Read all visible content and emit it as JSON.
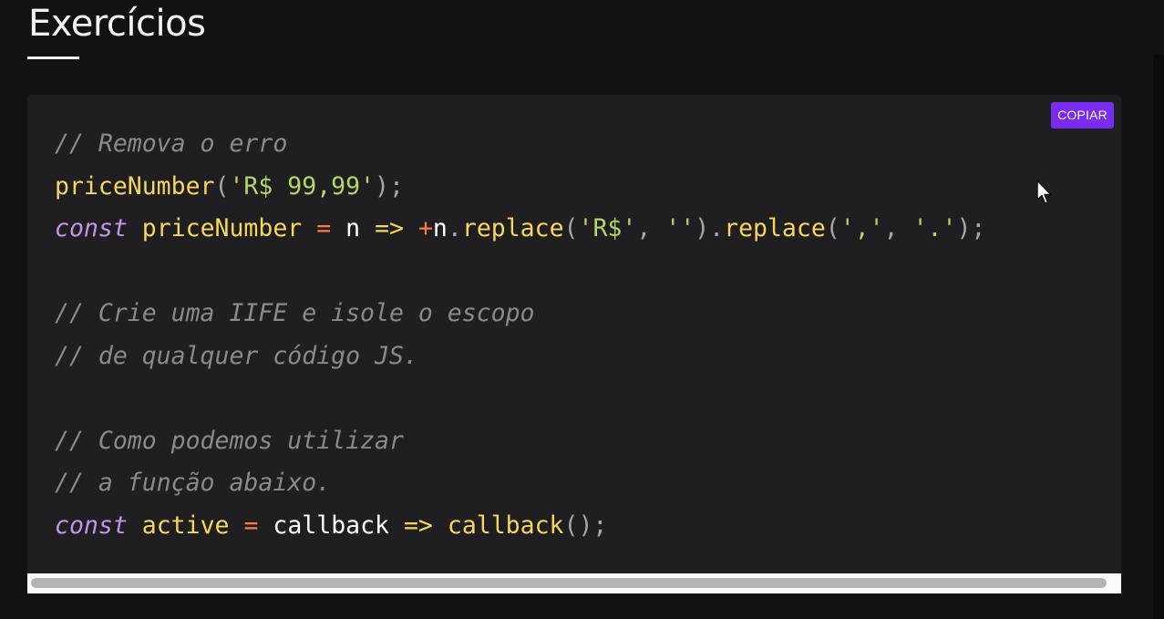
{
  "section": {
    "title": "Exercícios"
  },
  "code_block": {
    "copy_label": "COPIAR",
    "lines": [
      [
        {
          "t": "// Remova o erro",
          "c": "cm"
        }
      ],
      [
        {
          "t": "priceNumber",
          "c": "fn"
        },
        {
          "t": "(",
          "c": "pu"
        },
        {
          "t": "'R$ 99,99'",
          "c": "st"
        },
        {
          "t": ");",
          "c": "pu"
        }
      ],
      [
        {
          "t": "const",
          "c": "kw"
        },
        {
          "t": " ",
          "c": "id"
        },
        {
          "t": "priceNumber",
          "c": "fn"
        },
        {
          "t": " ",
          "c": "id"
        },
        {
          "t": "=",
          "c": "op"
        },
        {
          "t": " n ",
          "c": "id"
        },
        {
          "t": "=>",
          "c": "fn"
        },
        {
          "t": " ",
          "c": "id"
        },
        {
          "t": "+",
          "c": "op"
        },
        {
          "t": "n",
          "c": "id"
        },
        {
          "t": ".",
          "c": "pu"
        },
        {
          "t": "replace",
          "c": "fn"
        },
        {
          "t": "(",
          "c": "pu"
        },
        {
          "t": "'R$'",
          "c": "st"
        },
        {
          "t": ", ",
          "c": "pu"
        },
        {
          "t": "''",
          "c": "st"
        },
        {
          "t": ").",
          "c": "pu"
        },
        {
          "t": "replace",
          "c": "fn"
        },
        {
          "t": "(",
          "c": "pu"
        },
        {
          "t": "','",
          "c": "st"
        },
        {
          "t": ", ",
          "c": "pu"
        },
        {
          "t": "'.'",
          "c": "st"
        },
        {
          "t": ");",
          "c": "pu"
        }
      ],
      [],
      [
        {
          "t": "// Crie uma IIFE e isole o escopo",
          "c": "cm"
        }
      ],
      [
        {
          "t": "// de qualquer código JS.",
          "c": "cm"
        }
      ],
      [],
      [
        {
          "t": "// Como podemos utilizar",
          "c": "cm"
        }
      ],
      [
        {
          "t": "// a função abaixo.",
          "c": "cm"
        }
      ],
      [
        {
          "t": "const",
          "c": "kw"
        },
        {
          "t": " ",
          "c": "id"
        },
        {
          "t": "active",
          "c": "fn"
        },
        {
          "t": " ",
          "c": "id"
        },
        {
          "t": "=",
          "c": "op"
        },
        {
          "t": " callback ",
          "c": "id"
        },
        {
          "t": "=>",
          "c": "fn"
        },
        {
          "t": " ",
          "c": "id"
        },
        {
          "t": "callback",
          "c": "fn"
        },
        {
          "t": "();",
          "c": "pu"
        }
      ]
    ]
  },
  "colors": {
    "background": "#121214",
    "card": "#1f1f21",
    "accent": "#7a2bf0",
    "comment": "#8a8a8e",
    "keyword": "#c792ea",
    "function": "#f7d560",
    "string": "#b8d468",
    "operator": "#ff7a45"
  }
}
